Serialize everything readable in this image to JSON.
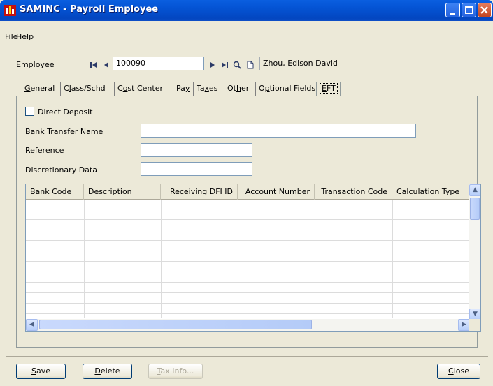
{
  "window": {
    "title": "SAMINC - Payroll Employee"
  },
  "menu": [
    {
      "key": "F",
      "rest": "ile"
    },
    {
      "key": "H",
      "rest": "elp"
    }
  ],
  "employee": {
    "label": "Employee",
    "id_value": "100090",
    "name_value": "Zhou, Edison David"
  },
  "tabs": [
    {
      "pre": "",
      "key": "G",
      "rest": "eneral"
    },
    {
      "pre": "C",
      "key": "l",
      "rest": "ass/Schd"
    },
    {
      "pre": "C",
      "key": "o",
      "rest": "st Center"
    },
    {
      "pre": "Pa",
      "key": "y",
      "rest": ""
    },
    {
      "pre": "Ta",
      "key": "x",
      "rest": "es"
    },
    {
      "pre": "Ot",
      "key": "h",
      "rest": "er"
    },
    {
      "pre": "O",
      "key": "p",
      "rest": "tional Fields"
    },
    {
      "pre": "",
      "key": "E",
      "rest": "FT"
    }
  ],
  "eft": {
    "direct_deposit_label": "Direct Deposit",
    "direct_deposit_checked": false,
    "bank_transfer_name_label": "Bank Transfer Name",
    "bank_transfer_name_value": "",
    "reference_label": "Reference",
    "reference_value": "",
    "discretionary_label": "Discretionary Data",
    "discretionary_value": ""
  },
  "grid": {
    "columns": [
      "Bank Code",
      "Description",
      "Receiving DFI ID",
      "Account Number",
      "Transaction Code",
      "Calculation Type"
    ],
    "rows": []
  },
  "buttons": {
    "save": {
      "key": "S",
      "rest": "ave"
    },
    "delete": {
      "key": "D",
      "rest": "elete"
    },
    "tax_info": {
      "key": "T",
      "rest": "ax Info..."
    },
    "close": {
      "key": "C",
      "rest": "lose"
    }
  }
}
